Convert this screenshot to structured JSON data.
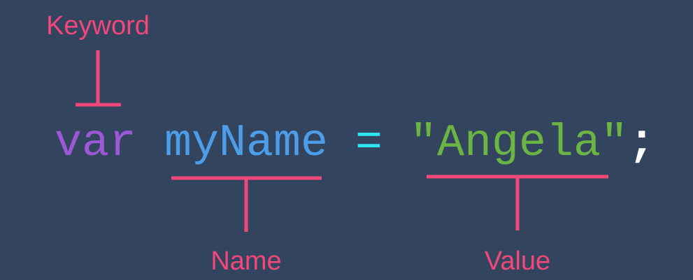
{
  "labels": {
    "keyword": "Keyword",
    "name": "Name",
    "value": "Value"
  },
  "code": {
    "keyword": "var",
    "name": "myName",
    "operator": "=",
    "value": "\"Angela\"",
    "terminator": ";"
  },
  "colors": {
    "background": "#33445f",
    "annotation": "#f2477a",
    "keyword": "#9b59d6",
    "name": "#4d9de8",
    "operator": "#2ee6ef",
    "value": "#6cb544",
    "terminator": "#ffffff"
  }
}
